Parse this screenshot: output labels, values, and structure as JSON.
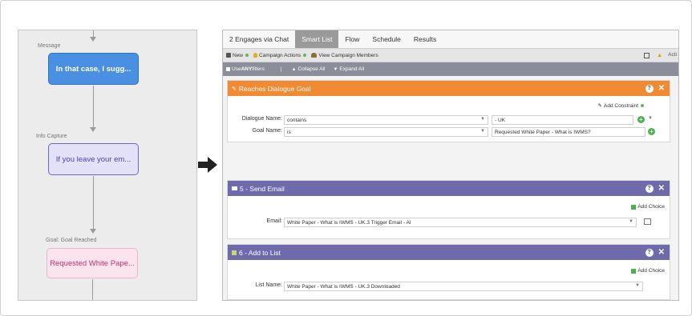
{
  "flow": {
    "message_label": "Message",
    "message_text": "In that case, I sugg...",
    "info_label": "Info Capture",
    "info_text": "If you leave your em...",
    "goal_label": "Goal: Goal Reached",
    "goal_text": "Requested White Pape..."
  },
  "app": {
    "tabs": [
      "2 Engages via Chat",
      "Smart List",
      "Flow",
      "Schedule",
      "Results"
    ],
    "active_tab": "Smart List",
    "toolbar1": {
      "new": "New",
      "campaign_actions": "Campaign Actions",
      "view_members": "View Campaign Members",
      "right_label": "Acti"
    },
    "toolbar2": {
      "use_prefix": "Use ",
      "use_any": "ANY",
      "use_suffix": " filters",
      "separator": "|",
      "collapse": "Collapse All",
      "expand": "Expand All"
    },
    "filter": {
      "title": "Reaches Dialogue Goal",
      "add_constraint": "Add Constraint",
      "dialogue_label": "Dialogue Name:",
      "dialogue_op": "contains",
      "dialogue_value": "- UK",
      "goal_label": "Goal Name:",
      "goal_op": "is",
      "goal_value": "Requested White Paper - What is IWMS?"
    },
    "flow_step1": {
      "title": "5 - Send Email",
      "add_choice": "Add Choice",
      "label": "Email:",
      "value": "White Paper - What is IWMS - UK.3 Trigger Email - AI"
    },
    "flow_step2": {
      "title": "6 - Add to List",
      "add_choice": "Add Choice",
      "label": "List Name:",
      "value": "White Paper - What is IWMS - UK.3 Downloaded"
    }
  },
  "colors": {
    "orange": "#f08a33",
    "purple": "#6f6aac",
    "message_blue": "#4a90e2",
    "info_purple": "#6c63d8",
    "goal_pink": "#c2306f"
  }
}
